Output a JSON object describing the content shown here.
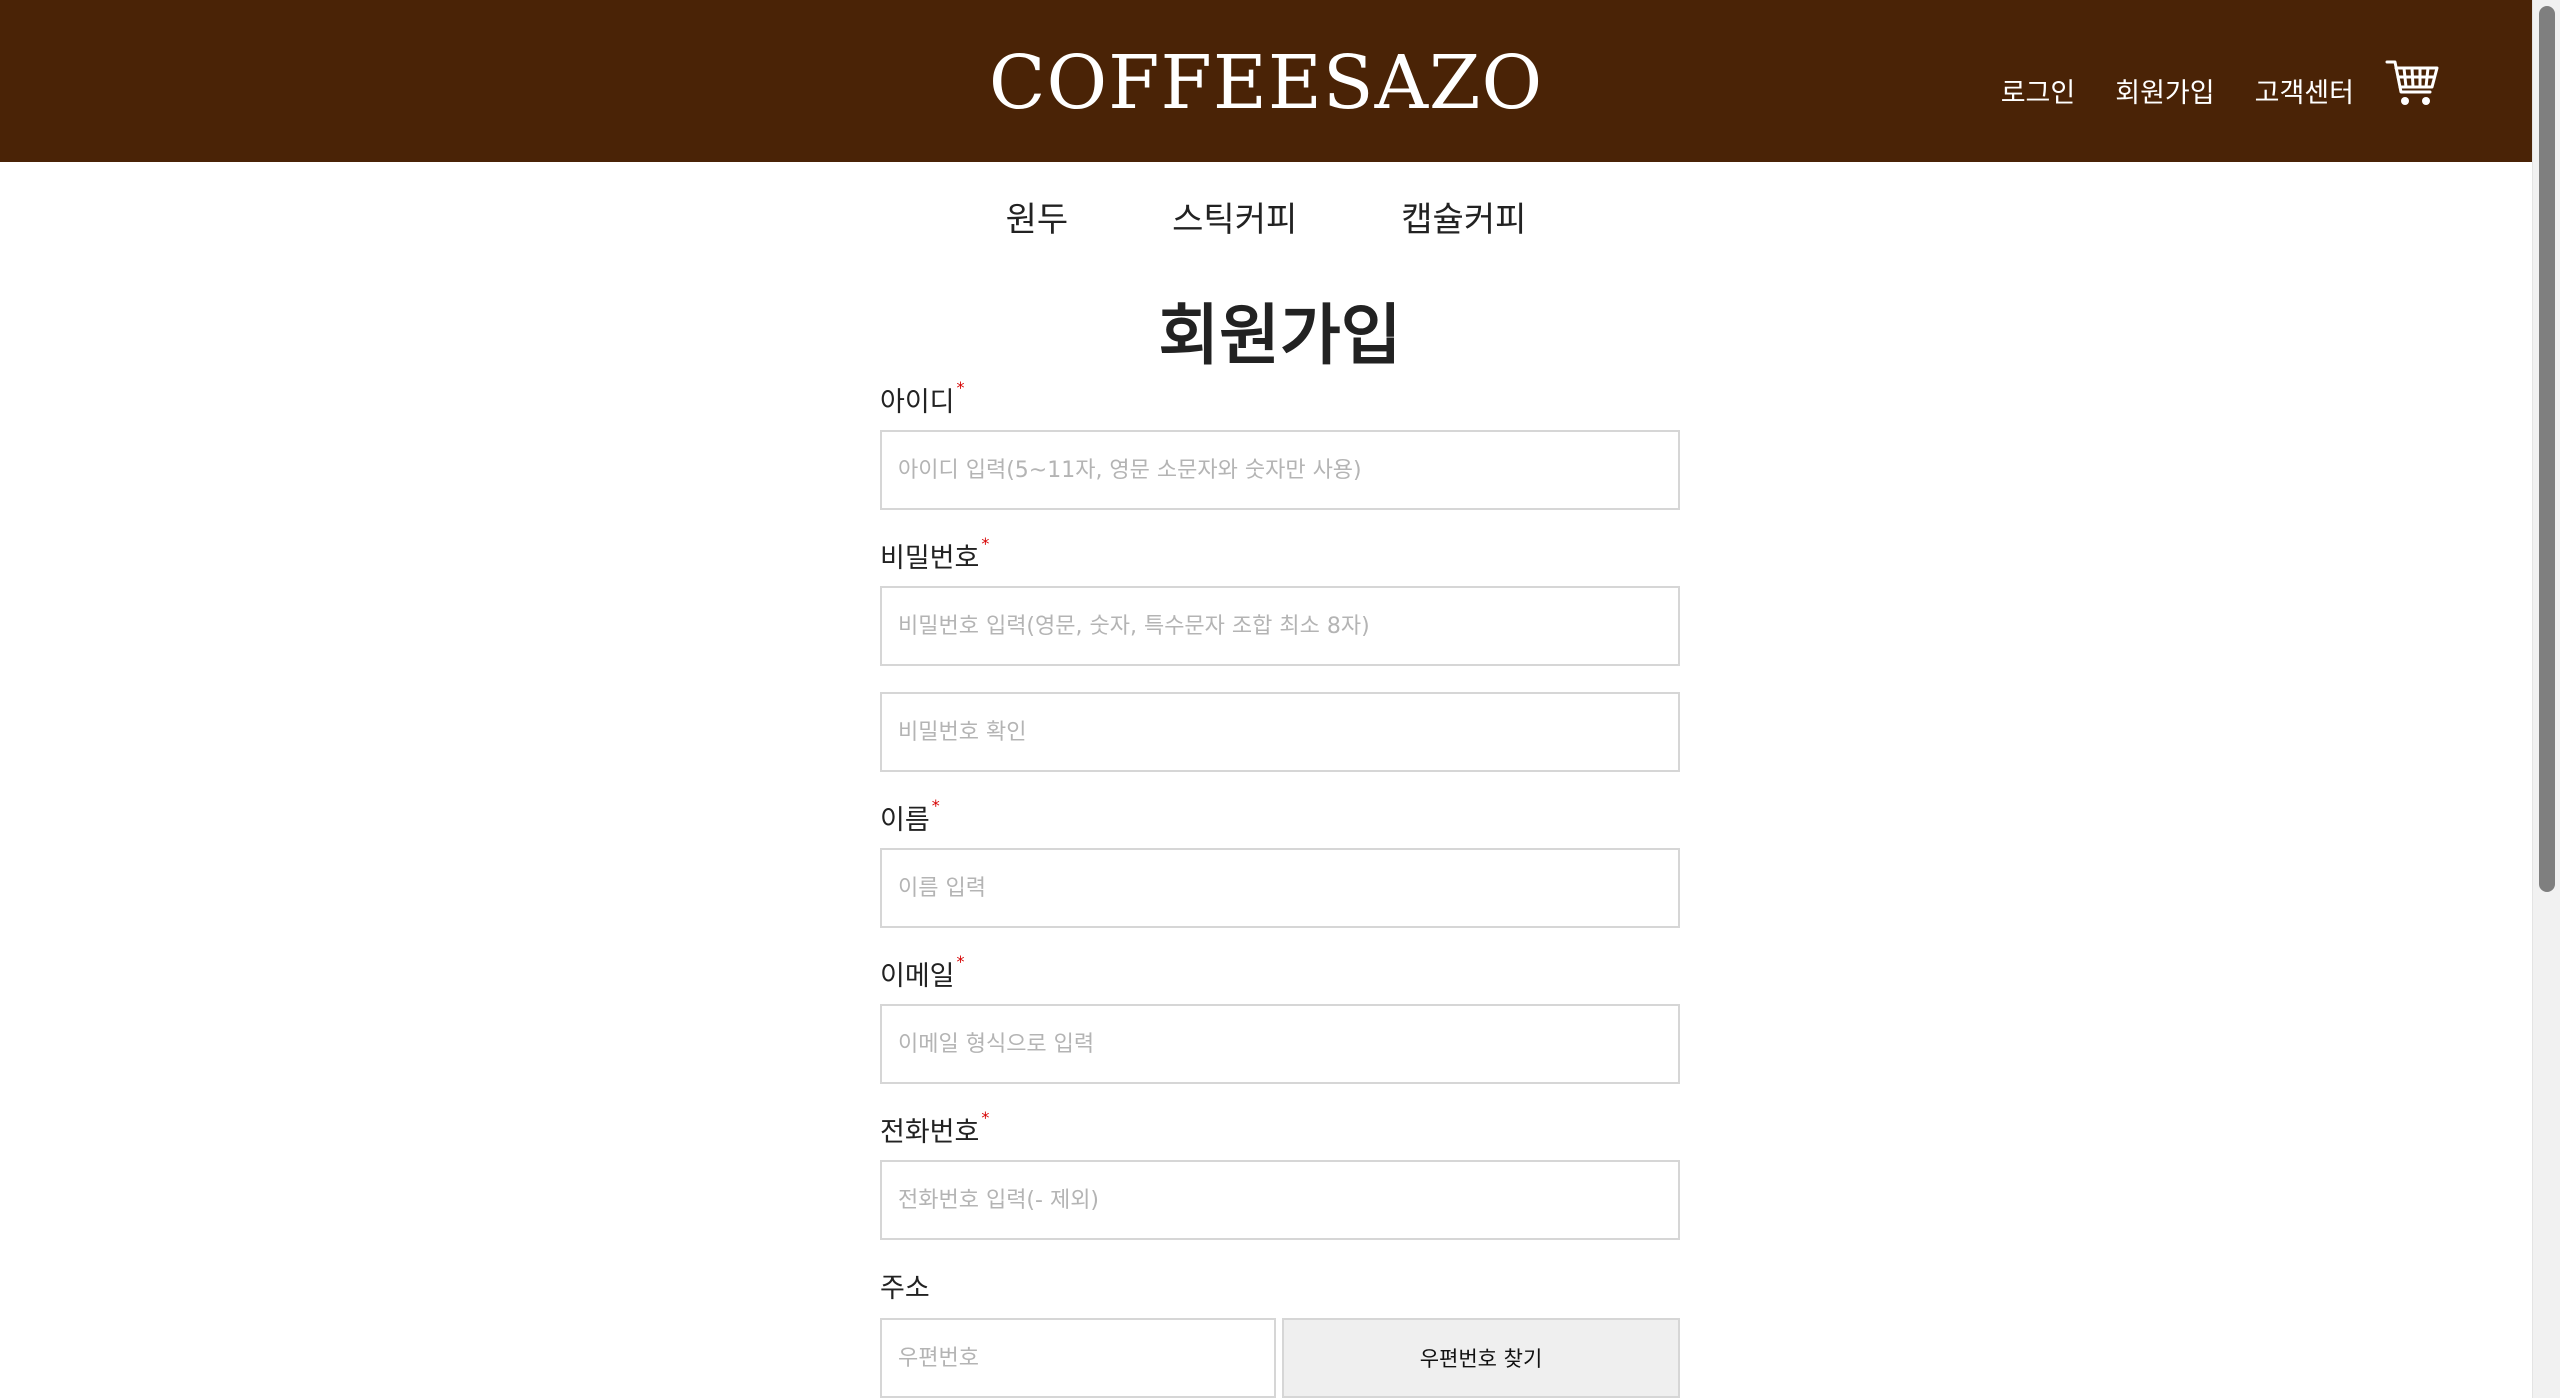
{
  "header": {
    "logo": "COFFEESAZO",
    "nav": {
      "login": "로그인",
      "signup": "회원가입",
      "support": "고객센터"
    },
    "cart_icon": "shopping-cart-icon"
  },
  "categories": [
    "원두",
    "스틱커피",
    "캡슐커피"
  ],
  "page_title": "회원가입",
  "form": {
    "id": {
      "label": "아이디",
      "required": "*",
      "placeholder": "아이디 입력(5~11자, 영문 소문자와 숫자만 사용)"
    },
    "password": {
      "label": "비밀번호",
      "required": "*",
      "placeholder": "비밀번호 입력(영문, 숫자, 특수문자 조합 최소 8자)"
    },
    "password_confirm": {
      "placeholder": "비밀번호 확인"
    },
    "name": {
      "label": "이름",
      "required": "*",
      "placeholder": "이름 입력"
    },
    "email": {
      "label": "이메일",
      "required": "*",
      "placeholder": "이메일 형식으로 입력"
    },
    "phone": {
      "label": "전화번호",
      "required": "*",
      "placeholder": "전화번호 입력(- 제외)"
    },
    "address": {
      "label": "주소",
      "zip_placeholder": "우편번호",
      "zip_button": "우편번호 찾기"
    }
  },
  "colors": {
    "header_bg": "#4a2306",
    "required_mark": "#d60000",
    "button_bg": "#efefef"
  }
}
